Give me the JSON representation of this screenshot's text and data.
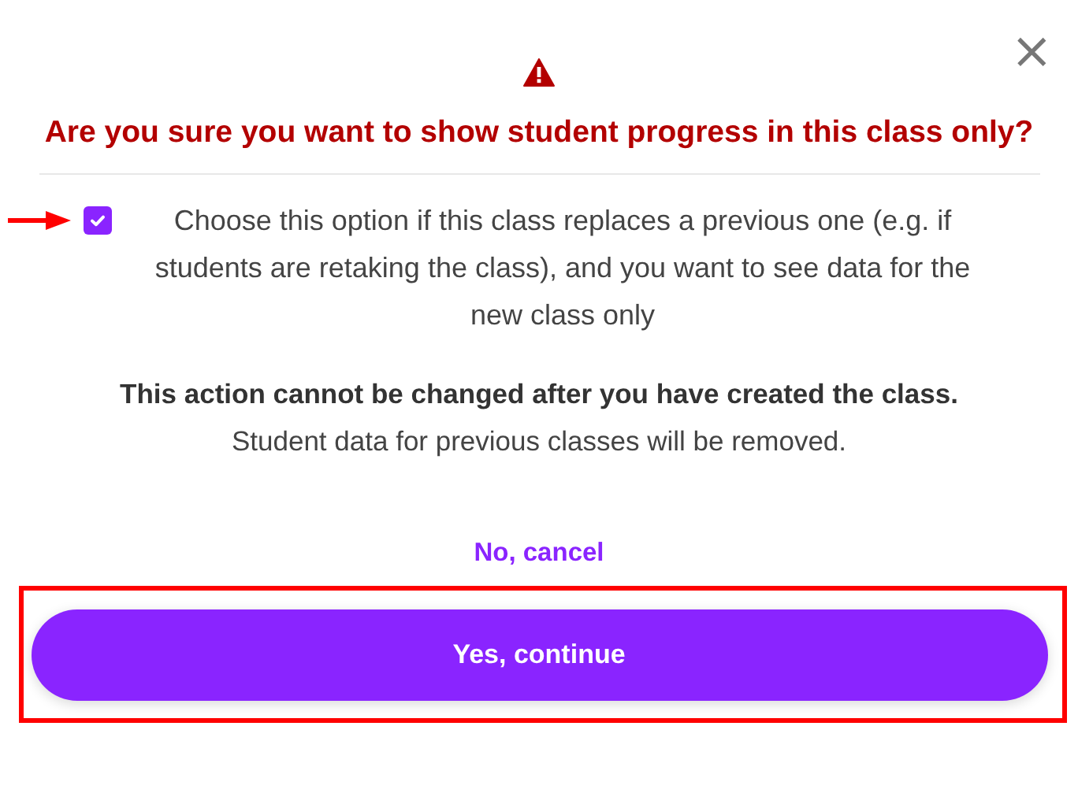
{
  "dialog": {
    "close": "×",
    "title": "Are you sure you want to show student progress in this class only?",
    "option": {
      "label": "Choose this option if this class replaces a previous one (e.g. if students are retaking the class), and you want to see data for the new class only",
      "checked": true
    },
    "warning": "This action cannot be changed after you have created the class.",
    "note": "Student data for previous classes will be removed.",
    "cancel": "No, cancel",
    "confirm": "Yes, continue"
  },
  "annotations": {
    "arrow_to_checkbox": true,
    "frame_around_continue": true
  }
}
